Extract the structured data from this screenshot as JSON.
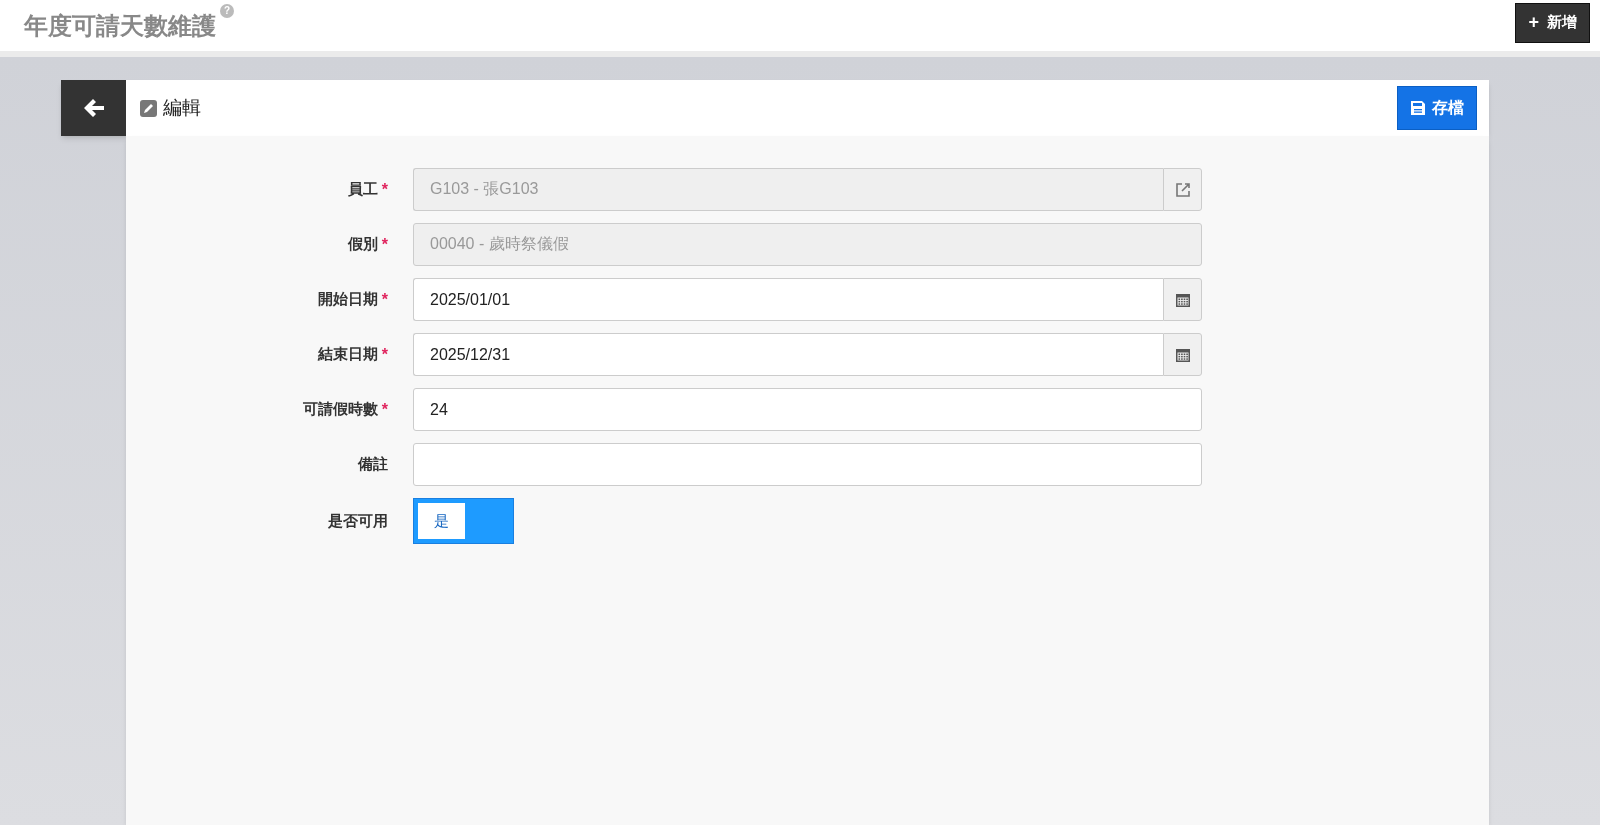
{
  "page": {
    "title": "年度可請天數維護",
    "help": "?"
  },
  "toolbar": {
    "add_button": {
      "icon": "+",
      "label": "新增"
    }
  },
  "card": {
    "title": "編輯",
    "save_button": "存檔",
    "fields": [
      {
        "kind": "text",
        "label": "員工",
        "required_mark": "*",
        "value": "G103 - 張G103",
        "disabled": true,
        "link_button": true
      },
      {
        "kind": "text",
        "label": "假別",
        "required_mark": "*",
        "value": "00040 - 歲時祭儀假",
        "disabled": true
      },
      {
        "kind": "text",
        "label": "開始日期",
        "required_mark": "*",
        "value": "2025/01/01",
        "disabled": false,
        "calendar_button": true
      },
      {
        "kind": "text",
        "label": "結束日期",
        "required_mark": "*",
        "value": "2025/12/31",
        "disabled": false,
        "calendar_button": true
      },
      {
        "kind": "text",
        "label": "可請假時數",
        "required_mark": "*",
        "value": "24",
        "disabled": false
      },
      {
        "kind": "text",
        "label": "備註",
        "disabled": false
      },
      {
        "kind": "toggle",
        "label": "是否可用",
        "on": true,
        "on_label": "是"
      }
    ]
  }
}
